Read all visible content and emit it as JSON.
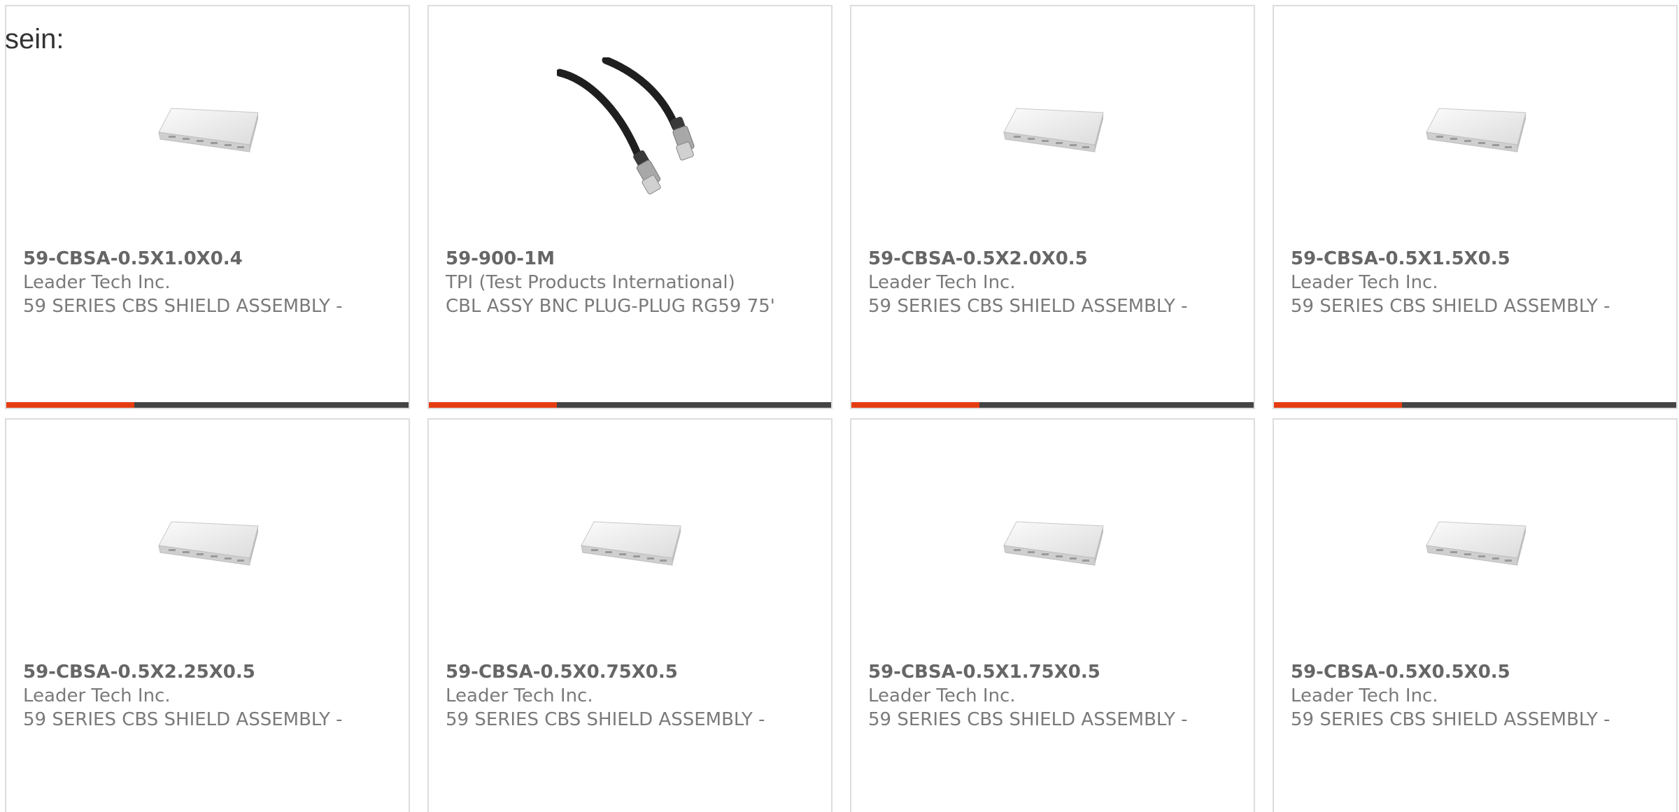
{
  "intro": {
    "text": "sein:"
  },
  "colors": {
    "accent": "#e43d12",
    "bar": "#444444",
    "card_border": "#dddddd",
    "text": "#7a7a7a"
  },
  "products": [
    {
      "part_number": "59-CBSA-0.5X1.0X0.4",
      "manufacturer": "Leader Tech Inc.",
      "description": "59 SERIES CBS SHIELD ASSEMBLY -",
      "image": "shield-image"
    },
    {
      "part_number": "59-900-1M",
      "manufacturer": "TPI (Test Products International)",
      "description": "CBL ASSY BNC PLUG-PLUG RG59 75'",
      "image": "cable-image"
    },
    {
      "part_number": "59-CBSA-0.5X2.0X0.5",
      "manufacturer": "Leader Tech Inc.",
      "description": "59 SERIES CBS SHIELD ASSEMBLY -",
      "image": "shield-image"
    },
    {
      "part_number": "59-CBSA-0.5X1.5X0.5",
      "manufacturer": "Leader Tech Inc.",
      "description": "59 SERIES CBS SHIELD ASSEMBLY -",
      "image": "shield-image"
    },
    {
      "part_number": "59-CBSA-0.5X2.25X0.5",
      "manufacturer": "Leader Tech Inc.",
      "description": "59 SERIES CBS SHIELD ASSEMBLY -",
      "image": "shield-image"
    },
    {
      "part_number": "59-CBSA-0.5X0.75X0.5",
      "manufacturer": "Leader Tech Inc.",
      "description": "59 SERIES CBS SHIELD ASSEMBLY -",
      "image": "shield-image"
    },
    {
      "part_number": "59-CBSA-0.5X1.75X0.5",
      "manufacturer": "Leader Tech Inc.",
      "description": "59 SERIES CBS SHIELD ASSEMBLY -",
      "image": "shield-image"
    },
    {
      "part_number": "59-CBSA-0.5X0.5X0.5",
      "manufacturer": "Leader Tech Inc.",
      "description": "59 SERIES CBS SHIELD ASSEMBLY -",
      "image": "shield-image"
    }
  ]
}
